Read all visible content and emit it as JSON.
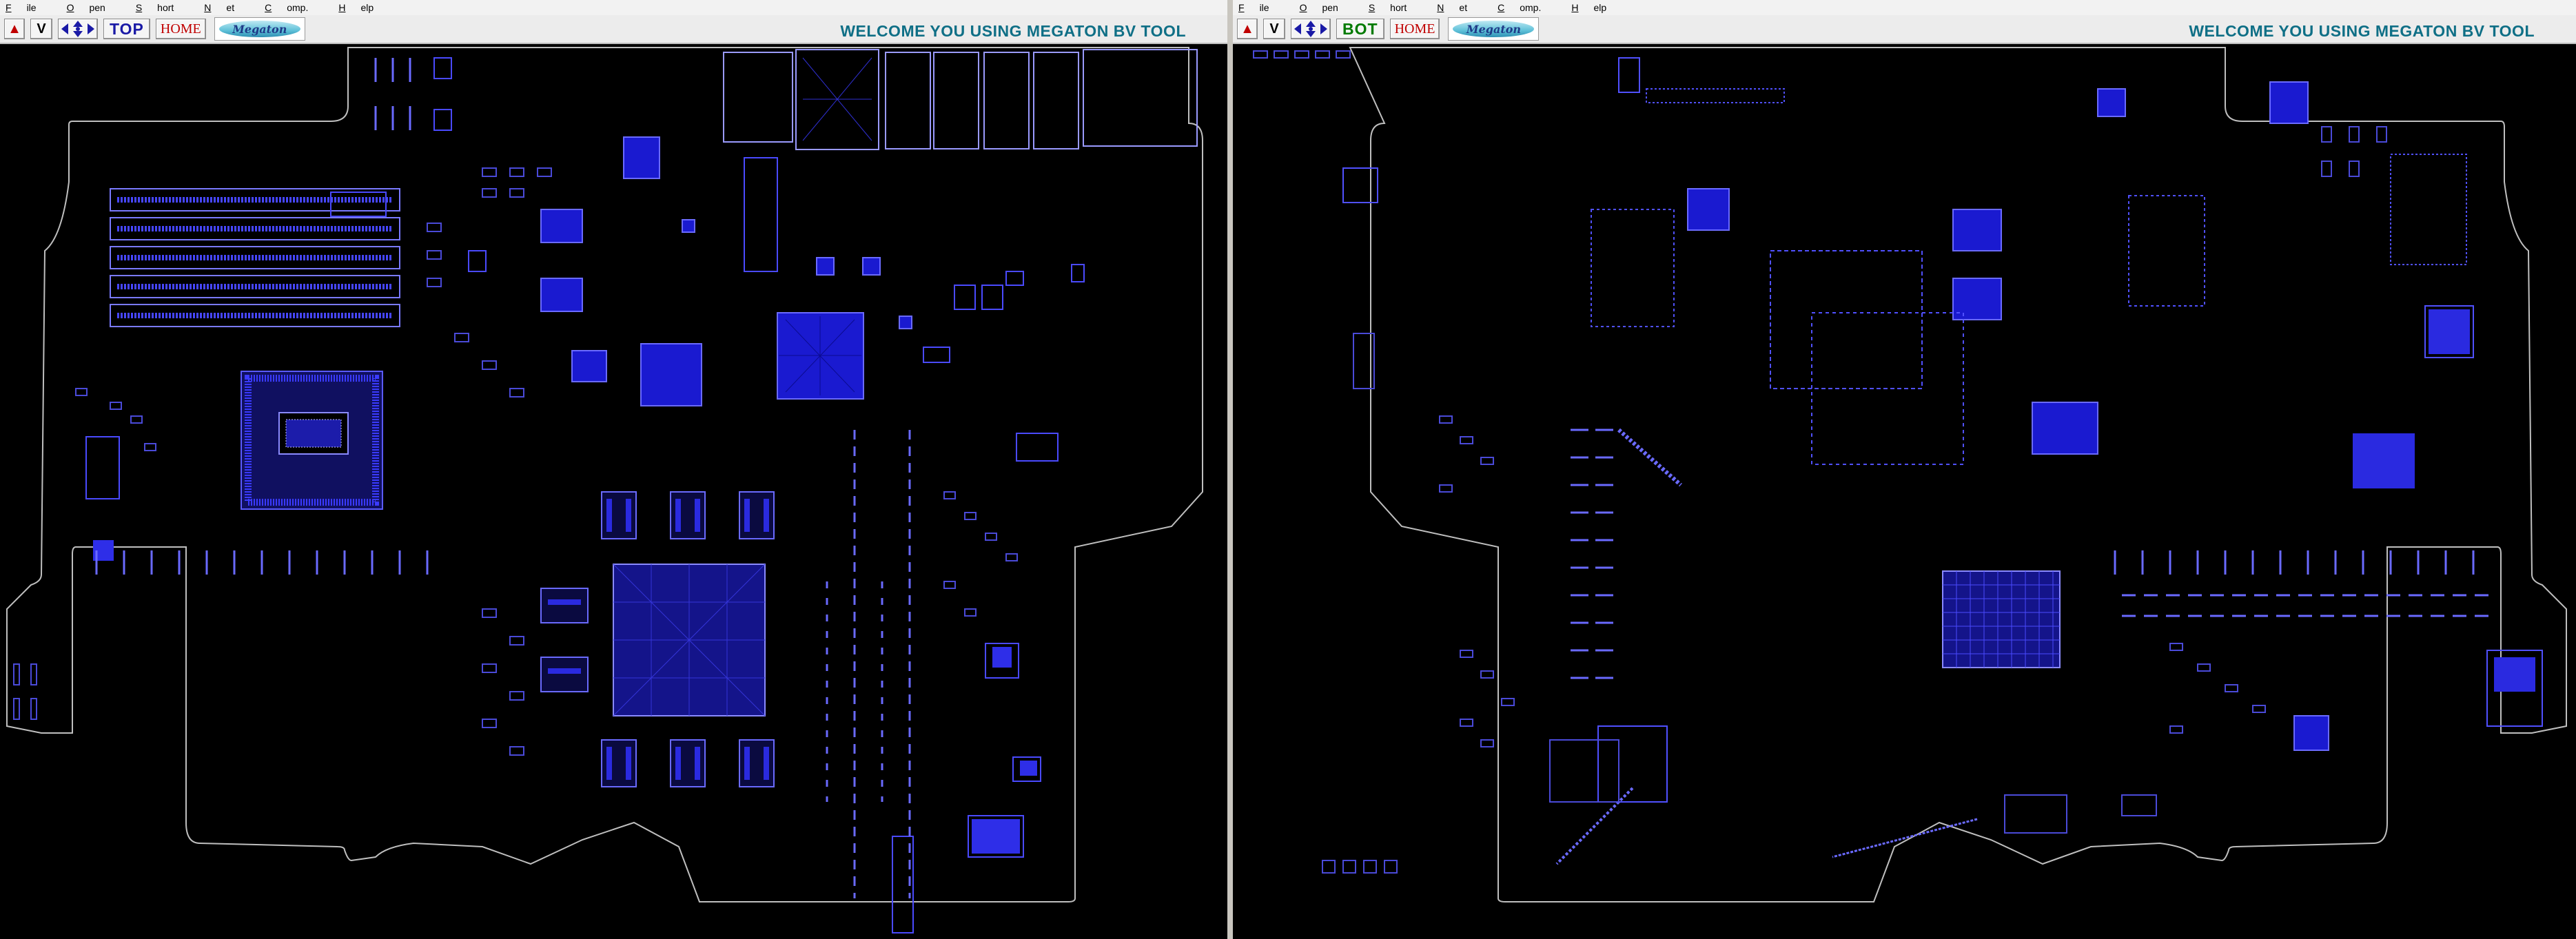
{
  "menu": [
    {
      "key": "F",
      "rest": "ile"
    },
    {
      "key": "O",
      "rest": "pen"
    },
    {
      "key": "S",
      "rest": "hort"
    },
    {
      "key": "N",
      "rest": "et"
    },
    {
      "key": "C",
      "rest": "omp."
    },
    {
      "key": "H",
      "rest": "elp"
    }
  ],
  "left_pane": {
    "side_label": "TOP",
    "side_color": "#1a1aa6",
    "home_label": "HOME",
    "v_label": "V",
    "logo_text": "Megaton",
    "welcome": "WELCOME YOU USING MEGATON BV TOOL"
  },
  "right_pane": {
    "side_label": "BOT",
    "side_color": "#007a00",
    "home_label": "HOME",
    "v_label": "V",
    "logo_text": "Megaton",
    "welcome": "WELCOME YOU USING MEGATON BV TOOL"
  },
  "icons": {
    "up": "up-arrow-icon",
    "nav": "four-way-arrows-icon"
  },
  "colors": {
    "board_background": "#000000",
    "outline": "#bfbfbf",
    "component": "#3a3aff",
    "welcome_text": "#0f6f86"
  }
}
